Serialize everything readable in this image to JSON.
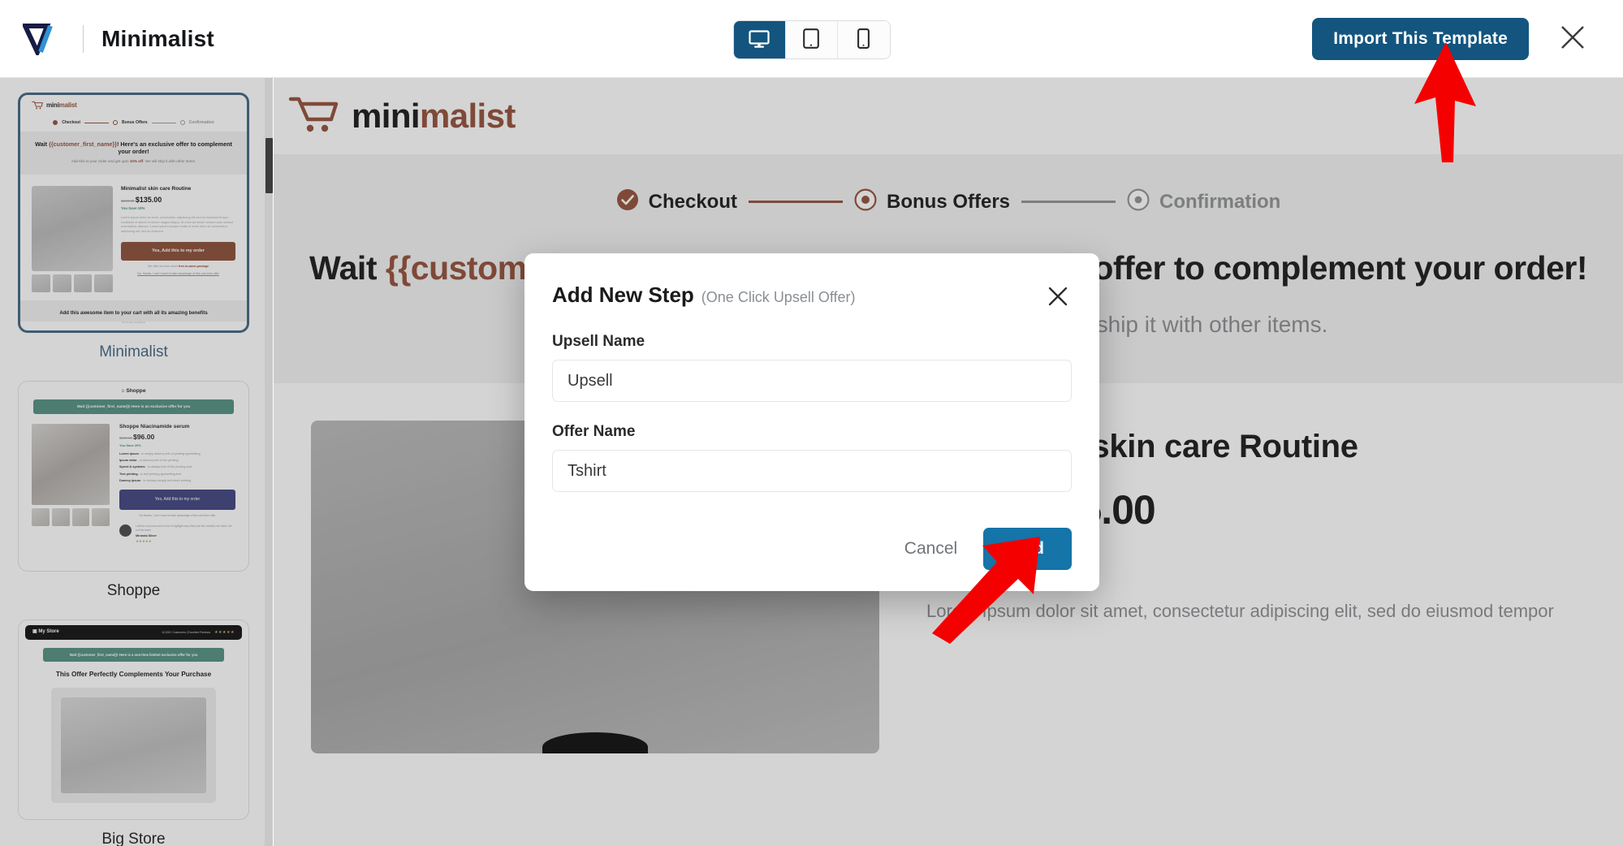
{
  "topbar": {
    "brand_title": "Minimalist",
    "logo_name": "vibe-logo",
    "devices": [
      {
        "name": "desktop",
        "label": "Desktop",
        "active": true
      },
      {
        "name": "tablet",
        "label": "Tablet",
        "active": false
      },
      {
        "name": "mobile",
        "label": "Mobile",
        "active": false
      }
    ],
    "import_label": "Import This Template",
    "close_label": "Close"
  },
  "colors": {
    "accent_blue": "#13557f",
    "button_blue": "#1574a8",
    "brand_orange": "#d6400f",
    "save_green": "#16a085",
    "arrow_red": "#f50000",
    "selected_border": "#1b6ea8"
  },
  "sidebar": {
    "templates": [
      {
        "label": "Minimalist",
        "selected": true
      },
      {
        "label": "Shoppe",
        "selected": false
      },
      {
        "label": "Big Store",
        "selected": false
      }
    ]
  },
  "preview": {
    "logo_part1": "mini",
    "logo_part2": "malist",
    "steps": [
      {
        "label": "Checkout",
        "state": "complete"
      },
      {
        "label": "Bonus Offers",
        "state": "current"
      },
      {
        "label": "Confirmation",
        "state": "upcoming"
      }
    ],
    "headline_pre": "Wait ",
    "headline_token": "{{customer_first_name}}",
    "headline_post": "! Here's an exclusive offer to complement your order!",
    "subhead_pre": "Add this to your order and get upto ",
    "subhead_em": "10% off",
    "subhead_post": ". We will ship it with other items.",
    "product_title": "Minimalist skin care Routine",
    "price_old": "$150.00",
    "price_new": "$135.00",
    "save_text": "You Save 10%",
    "description": "Lorem Ipsum dolor sit amet, consectetur adipiscing elit, sed do eiusmod tempor"
  },
  "thumb_minimalist": {
    "logo1": "mini",
    "logo2": "malist",
    "steps": [
      "Checkout",
      "Bonus Offers",
      "Confirmation"
    ],
    "h1_pre": "Wait ",
    "h1_token": "{{customer_first_name}}",
    "h1_post": "! Here's an exclusive offer to complement your order!",
    "sub_pre": "Add this to your order and get upto ",
    "sub_em": "10% off",
    "sub_post": ". We will ship it with other items.",
    "title": "Minimalist skin care Routine",
    "price_old": "$150.00",
    "price_new": "$135.00",
    "save": "You Save 10%",
    "lorem": "Lorem ipsum dolor sit amet, consectetur adipiscing elit sed do eiusmod tempor incididunt ut labore et dolore magna aliqua. Ut enim ad minim veniam quis nostrud exercitation ullamco. Lorem ipsum semper mollis et amet dolor sit consectetur adipiscing elit, sed do eiusmod.",
    "cta": "Yes, Add this to my order",
    "note_pre": "We offer the free return ",
    "note_em": "free-in-same-package",
    "decline": "No, thanks, I don't want to take advantage of this one-time offer",
    "footer": "Add this awesome item to your cart with all its amazing benefits",
    "footer_small": "Terms and Conditions"
  },
  "thumb_shoppe": {
    "logo": "Shoppe",
    "banner": "Wait {{customer_first_name}}! Here is an exclusive offer for you",
    "title": "Shoppe Niacinamide serum",
    "price_old": "$120.00",
    "price_new": "$96.00",
    "save": "You Save 20%",
    "bullets": [
      {
        "b": "Lorem ipsum",
        "t": " - is simply dummy text of printing typesetting"
      },
      {
        "b": "Ipsum dolor",
        "t": " - is dummy text of the printing"
      },
      {
        "b": "Speed & systems",
        "t": " - is always text of the printing and"
      },
      {
        "b": "Text printing",
        "t": " - is text printing typesetting text"
      },
      {
        "b": "Dummy ipsum",
        "t": " - is dummy simply text since printing"
      }
    ],
    "cta": "Yes, Add this to my order",
    "decline": "No thanks, I don't want to take advantage of this one-time offer",
    "review": "I will for such second of sure it highlight why they use the creation we have I be not the team",
    "reviewer": "Miranda Silver",
    "stars": "★★★★★"
  },
  "thumb_bigstore": {
    "logo": "My Store",
    "header_right": "10,000+ Customers  |  Excellent Reviews",
    "stars": "★★★★★",
    "banner": "Wait {{customer_first_name}}! Here is a one-time limited exclusive offer for you",
    "h1": "This Offer Perfectly Complements Your Purchase"
  },
  "modal": {
    "title": "Add New Step",
    "subtitle": "(One Click Upsell Offer)",
    "close_label": "Close dialog",
    "fields": [
      {
        "label": "Upsell Name",
        "value": "Upsell",
        "placeholder": "Upsell Name"
      },
      {
        "label": "Offer Name",
        "value": "Tshirt",
        "placeholder": "Offer Name"
      }
    ],
    "cancel_label": "Cancel",
    "add_label": "Add"
  },
  "annotations": [
    {
      "name": "arrow-to-import-button",
      "points_to": "Import This Template"
    },
    {
      "name": "arrow-to-add-button",
      "points_to": "Add"
    }
  ]
}
